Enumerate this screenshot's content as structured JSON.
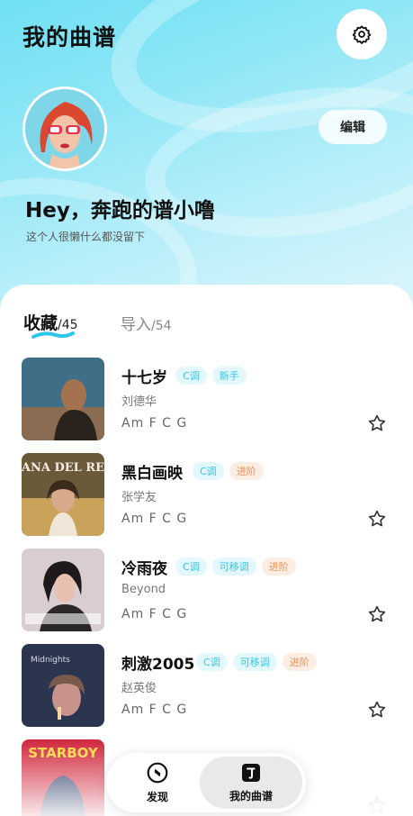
{
  "header": {
    "title": "我的曲谱",
    "settings_icon": "gear-icon"
  },
  "profile": {
    "edit_label": "编辑",
    "greeting": "Hey，奔跑的谱小噜",
    "bio": "这个人很懒什么都没留下"
  },
  "tabs": {
    "favorites": {
      "label": "收藏",
      "count": "/45"
    },
    "imported": {
      "label": "导入",
      "count": "/54"
    }
  },
  "songs": [
    {
      "title": "十七岁",
      "artist": "刘德华",
      "chords": "Am F C G",
      "tags": [
        {
          "text": "C调",
          "kind": "key"
        },
        {
          "text": "新手",
          "kind": "easy"
        }
      ]
    },
    {
      "title": "黑白画映",
      "artist": "张学友",
      "chords": "Am F C G",
      "tags": [
        {
          "text": "C调",
          "kind": "key"
        },
        {
          "text": "进阶",
          "kind": "adv"
        }
      ]
    },
    {
      "title": "冷雨夜",
      "artist": "Beyond",
      "chords": "Am F C G",
      "tags": [
        {
          "text": "C调",
          "kind": "key"
        },
        {
          "text": "可移调",
          "kind": "move"
        },
        {
          "text": "进阶",
          "kind": "adv"
        }
      ]
    },
    {
      "title": "刺激2005",
      "artist": "赵英俊",
      "chords": "Am F C G",
      "tags": [
        {
          "text": "C调",
          "kind": "key"
        },
        {
          "text": "可移调",
          "kind": "move"
        },
        {
          "text": "进阶",
          "kind": "adv"
        }
      ]
    }
  ],
  "covers": {
    "cover2_text": "LANA DEL REY",
    "cover4_text": "Midnights",
    "cover5_text": "STARBOY"
  },
  "nav": {
    "discover": "发现",
    "mine": "我的曲谱"
  },
  "colors": {
    "accent": "#3cc4e6",
    "advanced": "#f08f55",
    "hero_gradient": "#6fe0f3"
  }
}
